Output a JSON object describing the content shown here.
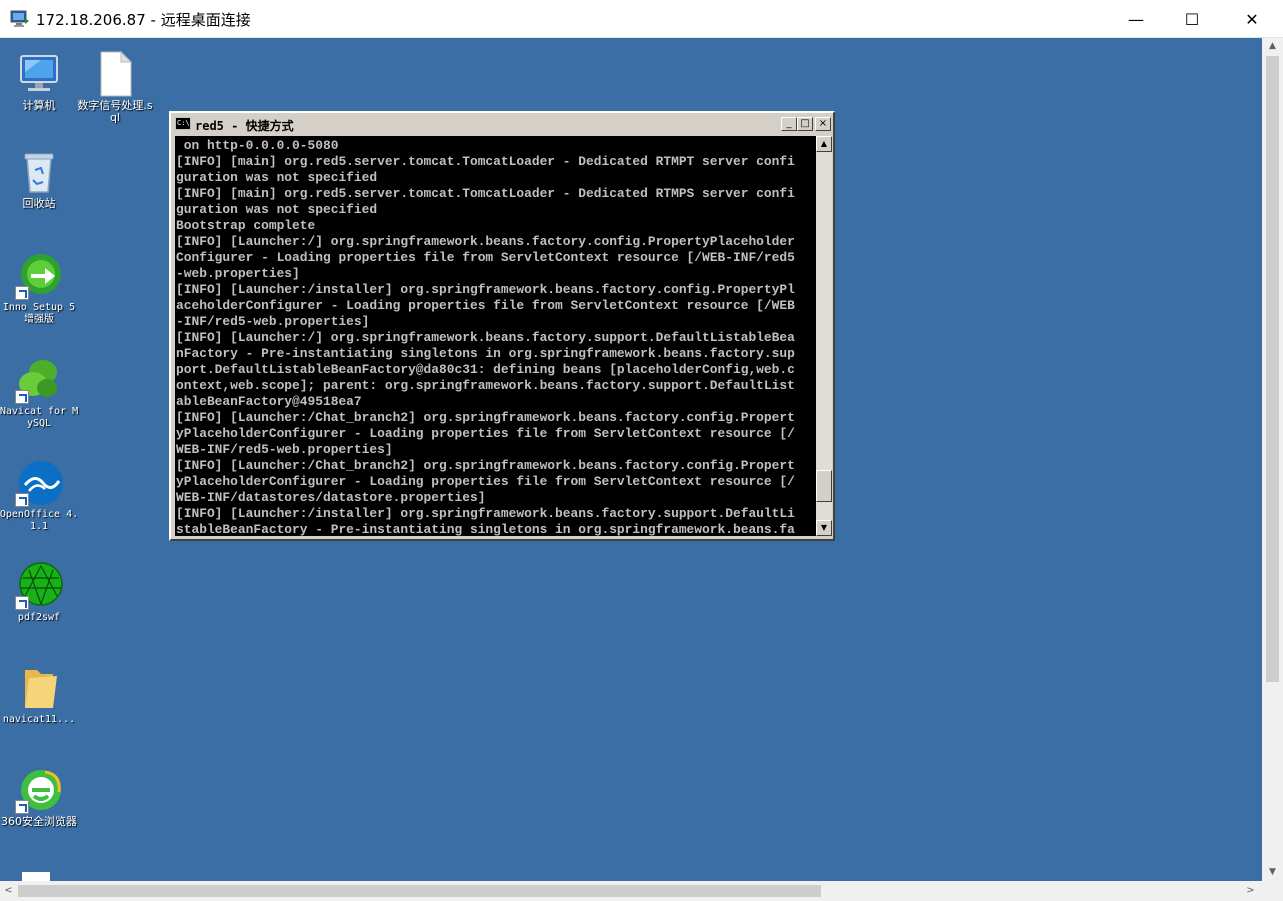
{
  "window": {
    "title": "172.18.206.87 - 远程桌面连接",
    "minimize_glyph": "—",
    "maximize_glyph": "☐",
    "close_glyph": "✕",
    "icon": "remote-desktop-icon"
  },
  "desktop": {
    "background_color": "#3a6ea5",
    "icons": [
      {
        "label": "计算机",
        "icon": "computer-icon"
      },
      {
        "label": "数字信号处理.sql",
        "icon": "file-icon"
      },
      {
        "label": "回收站",
        "icon": "recycle-bin-icon"
      },
      {
        "label": "Inno Setup 5 增强版",
        "icon": "inno-setup-icon"
      },
      {
        "label": "Navicat for MySQL",
        "icon": "navicat-icon"
      },
      {
        "label": "OpenOffice 4.1.1",
        "icon": "openoffice-icon"
      },
      {
        "label": "pdf2swf",
        "icon": "pdf2swf-icon"
      },
      {
        "label": "navicat11...",
        "icon": "folder-icon"
      },
      {
        "label": "360安全浏览器",
        "icon": "360-browser-icon"
      }
    ]
  },
  "console": {
    "title": "red5 - 快捷方式",
    "icon_text": "C:\\",
    "min_glyph": "_",
    "max_glyph": "□",
    "close_glyph": "×",
    "lines": [
      " on http-0.0.0.0-5080",
      "[INFO] [main] org.red5.server.tomcat.TomcatLoader - Dedicated RTMPT server confi",
      "guration was not specified",
      "[INFO] [main] org.red5.server.tomcat.TomcatLoader - Dedicated RTMPS server confi",
      "guration was not specified",
      "Bootstrap complete",
      "[INFO] [Launcher:/] org.springframework.beans.factory.config.PropertyPlaceholder",
      "Configurer - Loading properties file from ServletContext resource [/WEB-INF/red5",
      "-web.properties]",
      "[INFO] [Launcher:/installer] org.springframework.beans.factory.config.PropertyPl",
      "aceholderConfigurer - Loading properties file from ServletContext resource [/WEB",
      "-INF/red5-web.properties]",
      "[INFO] [Launcher:/] org.springframework.beans.factory.support.DefaultListableBea",
      "nFactory - Pre-instantiating singletons in org.springframework.beans.factory.sup",
      "port.DefaultListableBeanFactory@da80c31: defining beans [placeholderConfig,web.c",
      "ontext,web.scope]; parent: org.springframework.beans.factory.support.DefaultList",
      "ableBeanFactory@49518ea7",
      "[INFO] [Launcher:/Chat_branch2] org.springframework.beans.factory.config.Propert",
      "yPlaceholderConfigurer - Loading properties file from ServletContext resource [/",
      "WEB-INF/red5-web.properties]",
      "[INFO] [Launcher:/Chat_branch2] org.springframework.beans.factory.config.Propert",
      "yPlaceholderConfigurer - Loading properties file from ServletContext resource [/",
      "WEB-INF/datastores/datastore.properties]",
      "[INFO] [Launcher:/installer] org.springframework.beans.factory.support.DefaultLi",
      "stableBeanFactory - Pre-instantiating singletons in org.springframework.beans.fa"
    ]
  },
  "scrollbars": {
    "up_glyph": "▲",
    "down_glyph": "▼",
    "left_glyph": "<",
    "right_glyph": ">",
    "console_up_glyph": "▲",
    "console_down_glyph": "▼"
  }
}
